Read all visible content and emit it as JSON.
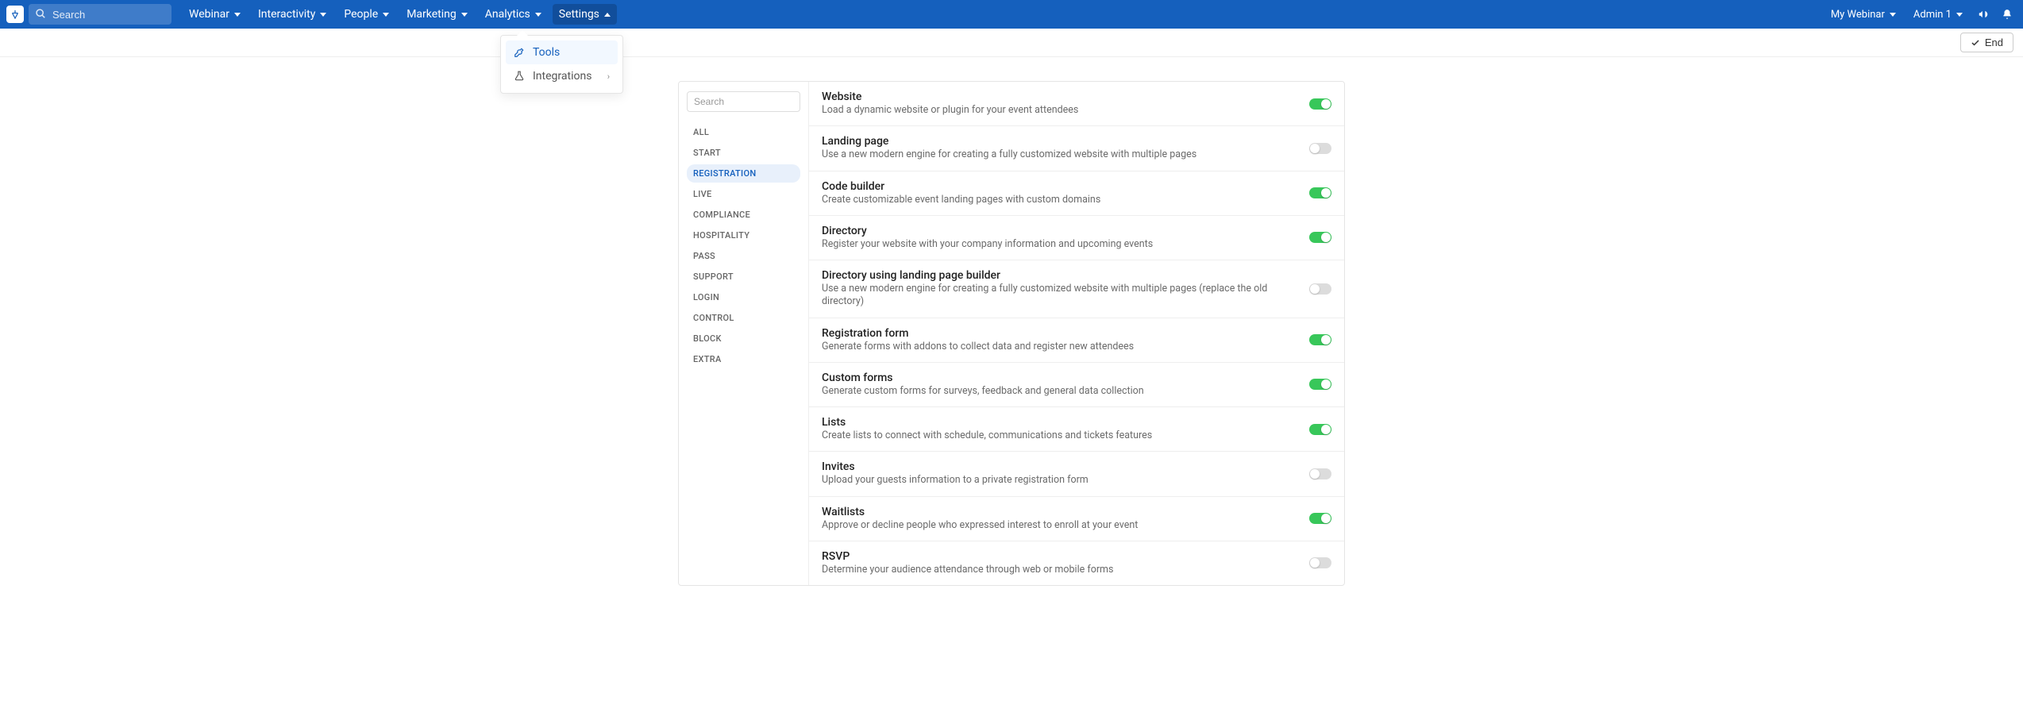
{
  "topnav": {
    "search_placeholder": "Search",
    "items": [
      {
        "label": "Webinar"
      },
      {
        "label": "Interactivity"
      },
      {
        "label": "People"
      },
      {
        "label": "Marketing"
      },
      {
        "label": "Analytics"
      },
      {
        "label": "Settings",
        "active": true
      }
    ],
    "right": {
      "my_webinar": "My Webinar",
      "admin": "Admin 1"
    }
  },
  "subbar": {
    "end_label": "End"
  },
  "dropdown": {
    "items": [
      {
        "label": "Tools",
        "active": true,
        "icon": "wrench"
      },
      {
        "label": "Integrations",
        "active": false,
        "icon": "flask",
        "submenu": true
      }
    ]
  },
  "sidebar": {
    "search_placeholder": "Search",
    "items": [
      {
        "label": "ALL"
      },
      {
        "label": "START"
      },
      {
        "label": "REGISTRATION",
        "active": true
      },
      {
        "label": "LIVE"
      },
      {
        "label": "COMPLIANCE"
      },
      {
        "label": "HOSPITALITY"
      },
      {
        "label": "PASS"
      },
      {
        "label": "SUPPORT"
      },
      {
        "label": "LOGIN"
      },
      {
        "label": "CONTROL"
      },
      {
        "label": "BLOCK"
      },
      {
        "label": "EXTRA"
      }
    ]
  },
  "settings": [
    {
      "title": "Website",
      "desc": "Load a dynamic website or plugin for your event attendees",
      "on": true
    },
    {
      "title": "Landing page",
      "desc": "Use a new modern engine for creating a fully customized website with multiple pages",
      "on": false
    },
    {
      "title": "Code builder",
      "desc": "Create customizable event landing pages with custom domains",
      "on": true
    },
    {
      "title": "Directory",
      "desc": "Register your website with your company information and upcoming events",
      "on": true
    },
    {
      "title": "Directory using landing page builder",
      "desc": "Use a new modern engine for creating a fully customized website with multiple pages (replace the old directory)",
      "on": false
    },
    {
      "title": "Registration form",
      "desc": "Generate forms with addons to collect data and register new attendees",
      "on": true
    },
    {
      "title": "Custom forms",
      "desc": "Generate custom forms for surveys, feedback and general data collection",
      "on": true
    },
    {
      "title": "Lists",
      "desc": "Create lists to connect with schedule, communications and tickets features",
      "on": true
    },
    {
      "title": "Invites",
      "desc": "Upload your guests information to a private registration form",
      "on": false
    },
    {
      "title": "Waitlists",
      "desc": "Approve or decline people who expressed interest to enroll at your event",
      "on": true
    },
    {
      "title": "RSVP",
      "desc": "Determine your audience attendance through web or mobile forms",
      "on": false
    }
  ]
}
